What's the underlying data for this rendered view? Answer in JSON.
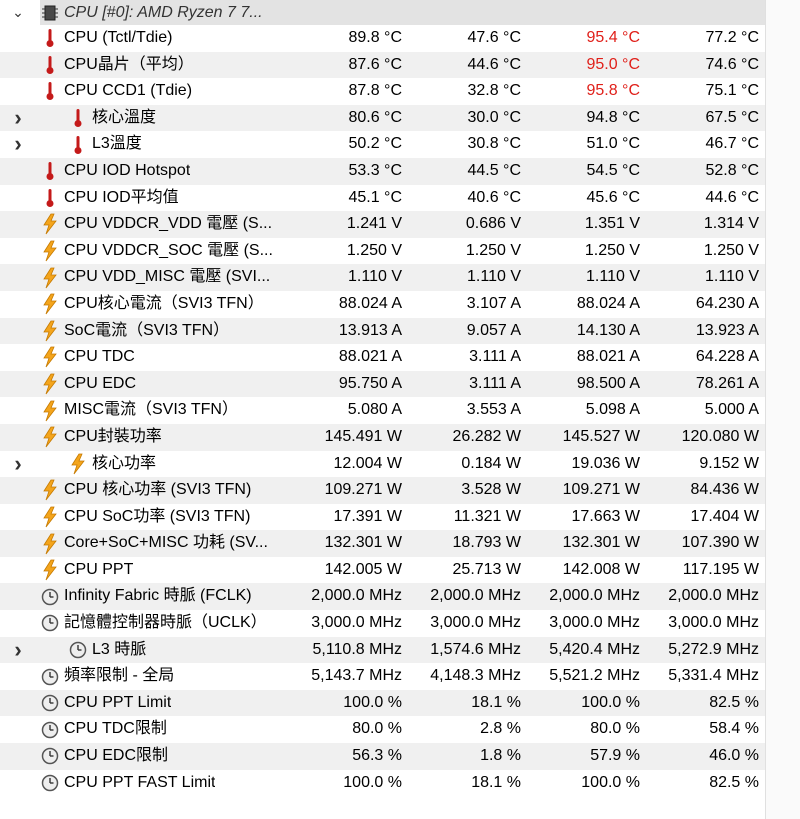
{
  "header": {
    "label": "CPU [#0]: AMD Ryzen 7 7...",
    "icon": "chip-icon"
  },
  "rows": [
    {
      "label": "CPU (Tctl/Tdie)",
      "icon": "thermometer-icon",
      "indent": false,
      "expandable": false,
      "values": [
        "89.8 °C",
        "47.6 °C",
        "95.4 °C",
        "77.2 °C"
      ],
      "max_red": true
    },
    {
      "label": "CPU晶片（平均）",
      "icon": "thermometer-icon",
      "indent": false,
      "expandable": false,
      "values": [
        "87.6 °C",
        "44.6 °C",
        "95.0 °C",
        "74.6 °C"
      ],
      "max_red": true
    },
    {
      "label": "CPU CCD1 (Tdie)",
      "icon": "thermometer-icon",
      "indent": false,
      "expandable": false,
      "values": [
        "87.8 °C",
        "32.8 °C",
        "95.8 °C",
        "75.1 °C"
      ],
      "max_red": true
    },
    {
      "label": "核心溫度",
      "icon": "thermometer-icon",
      "indent": true,
      "expandable": true,
      "values": [
        "80.6 °C",
        "30.0 °C",
        "94.8 °C",
        "67.5 °C"
      ],
      "max_red": false
    },
    {
      "label": "L3溫度",
      "icon": "thermometer-icon",
      "indent": true,
      "expandable": true,
      "values": [
        "50.2 °C",
        "30.8 °C",
        "51.0 °C",
        "46.7 °C"
      ],
      "max_red": false
    },
    {
      "label": "CPU IOD Hotspot",
      "icon": "thermometer-icon",
      "indent": false,
      "expandable": false,
      "values": [
        "53.3 °C",
        "44.5 °C",
        "54.5 °C",
        "52.8 °C"
      ],
      "max_red": false
    },
    {
      "label": "CPU IOD平均值",
      "icon": "thermometer-icon",
      "indent": false,
      "expandable": false,
      "values": [
        "45.1 °C",
        "40.6 °C",
        "45.6 °C",
        "44.6 °C"
      ],
      "max_red": false
    },
    {
      "label": "CPU VDDCR_VDD 電壓 (S...",
      "icon": "lightning-icon",
      "indent": false,
      "expandable": false,
      "values": [
        "1.241 V",
        "0.686 V",
        "1.351 V",
        "1.314 V"
      ],
      "max_red": false
    },
    {
      "label": "CPU VDDCR_SOC 電壓 (S...",
      "icon": "lightning-icon",
      "indent": false,
      "expandable": false,
      "values": [
        "1.250 V",
        "1.250 V",
        "1.250 V",
        "1.250 V"
      ],
      "max_red": false
    },
    {
      "label": "CPU VDD_MISC 電壓 (SVI...",
      "icon": "lightning-icon",
      "indent": false,
      "expandable": false,
      "values": [
        "1.110 V",
        "1.110 V",
        "1.110 V",
        "1.110 V"
      ],
      "max_red": false
    },
    {
      "label": "CPU核心電流（SVI3 TFN）",
      "icon": "lightning-icon",
      "indent": false,
      "expandable": false,
      "values": [
        "88.024 A",
        "3.107 A",
        "88.024 A",
        "64.230 A"
      ],
      "max_red": false
    },
    {
      "label": "SoC電流（SVI3 TFN）",
      "icon": "lightning-icon",
      "indent": false,
      "expandable": false,
      "values": [
        "13.913 A",
        "9.057 A",
        "14.130 A",
        "13.923 A"
      ],
      "max_red": false
    },
    {
      "label": "CPU TDC",
      "icon": "lightning-icon",
      "indent": false,
      "expandable": false,
      "values": [
        "88.021 A",
        "3.111 A",
        "88.021 A",
        "64.228 A"
      ],
      "max_red": false
    },
    {
      "label": "CPU EDC",
      "icon": "lightning-icon",
      "indent": false,
      "expandable": false,
      "values": [
        "95.750 A",
        "3.111 A",
        "98.500 A",
        "78.261 A"
      ],
      "max_red": false
    },
    {
      "label": "MISC電流（SVI3 TFN）",
      "icon": "lightning-icon",
      "indent": false,
      "expandable": false,
      "values": [
        "5.080 A",
        "3.553 A",
        "5.098 A",
        "5.000 A"
      ],
      "max_red": false
    },
    {
      "label": "CPU封裝功率",
      "icon": "lightning-icon",
      "indent": false,
      "expandable": false,
      "values": [
        "145.491 W",
        "26.282 W",
        "145.527 W",
        "120.080 W"
      ],
      "max_red": false
    },
    {
      "label": "核心功率",
      "icon": "lightning-icon",
      "indent": true,
      "expandable": true,
      "values": [
        "12.004 W",
        "0.184 W",
        "19.036 W",
        "9.152 W"
      ],
      "max_red": false
    },
    {
      "label": "CPU 核心功率 (SVI3 TFN)",
      "icon": "lightning-icon",
      "indent": false,
      "expandable": false,
      "values": [
        "109.271 W",
        "3.528 W",
        "109.271 W",
        "84.436 W"
      ],
      "max_red": false
    },
    {
      "label": "CPU SoC功率 (SVI3 TFN)",
      "icon": "lightning-icon",
      "indent": false,
      "expandable": false,
      "values": [
        "17.391 W",
        "11.321 W",
        "17.663 W",
        "17.404 W"
      ],
      "max_red": false
    },
    {
      "label": "Core+SoC+MISC 功耗 (SV...",
      "icon": "lightning-icon",
      "indent": false,
      "expandable": false,
      "values": [
        "132.301 W",
        "18.793 W",
        "132.301 W",
        "107.390 W"
      ],
      "max_red": false
    },
    {
      "label": "CPU PPT",
      "icon": "lightning-icon",
      "indent": false,
      "expandable": false,
      "values": [
        "142.005 W",
        "25.713 W",
        "142.008 W",
        "117.195 W"
      ],
      "max_red": false
    },
    {
      "label": "Infinity Fabric 時脈 (FCLK)",
      "icon": "clock-icon",
      "indent": false,
      "expandable": false,
      "values": [
        "2,000.0 MHz",
        "2,000.0 MHz",
        "2,000.0 MHz",
        "2,000.0 MHz"
      ],
      "max_red": false
    },
    {
      "label": "記憶體控制器時脈（UCLK）",
      "icon": "clock-icon",
      "indent": false,
      "expandable": false,
      "values": [
        "3,000.0 MHz",
        "3,000.0 MHz",
        "3,000.0 MHz",
        "3,000.0 MHz"
      ],
      "max_red": false
    },
    {
      "label": "L3 時脈",
      "icon": "clock-icon",
      "indent": true,
      "expandable": true,
      "values": [
        "5,110.8 MHz",
        "1,574.6 MHz",
        "5,420.4 MHz",
        "5,272.9 MHz"
      ],
      "max_red": false
    },
    {
      "label": "頻率限制 - 全局",
      "icon": "clock-icon",
      "indent": false,
      "expandable": false,
      "values": [
        "5,143.7 MHz",
        "4,148.3 MHz",
        "5,521.2 MHz",
        "5,331.4 MHz"
      ],
      "max_red": false
    },
    {
      "label": "CPU PPT Limit",
      "icon": "clock-icon",
      "indent": false,
      "expandable": false,
      "values": [
        "100.0 %",
        "18.1 %",
        "100.0 %",
        "82.5 %"
      ],
      "max_red": false
    },
    {
      "label": "CPU TDC限制",
      "icon": "clock-icon",
      "indent": false,
      "expandable": false,
      "values": [
        "80.0 %",
        "2.8 %",
        "80.0 %",
        "58.4 %"
      ],
      "max_red": false
    },
    {
      "label": "CPU EDC限制",
      "icon": "clock-icon",
      "indent": false,
      "expandable": false,
      "values": [
        "56.3 %",
        "1.8 %",
        "57.9 %",
        "46.0 %"
      ],
      "max_red": false
    },
    {
      "label": "CPU PPT FAST Limit",
      "icon": "clock-icon",
      "indent": false,
      "expandable": false,
      "values": [
        "100.0 %",
        "18.1 %",
        "100.0 %",
        "82.5 %"
      ],
      "max_red": false
    }
  ],
  "colors": {
    "max_exceeded": "#e0201a",
    "alt_row": "#f0f0f0",
    "header_bg": "#e3e3e3"
  }
}
